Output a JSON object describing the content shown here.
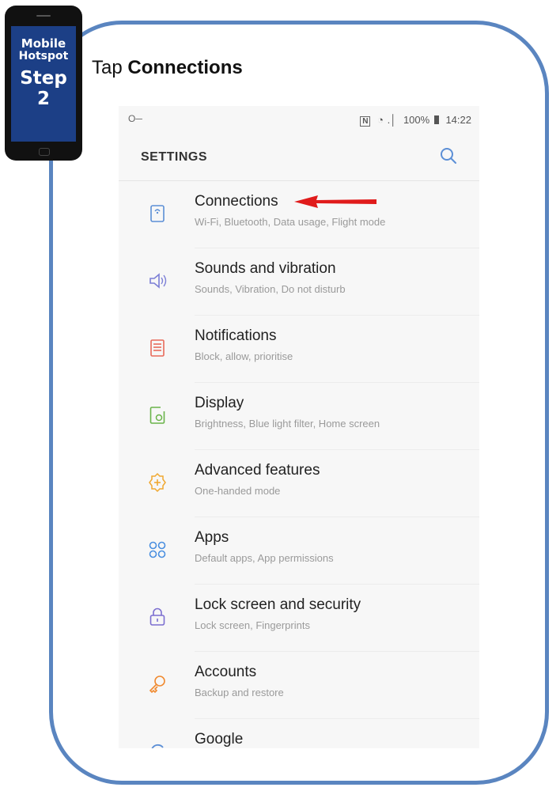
{
  "badge": {
    "line1": "Mobile",
    "line2": "Hotspot",
    "line3": "Step",
    "line4": "2"
  },
  "instruction": {
    "prefix": "Tap ",
    "target": "Connections"
  },
  "status_bar": {
    "key_icon": "key-icon",
    "nfc": "N",
    "battery": "100%",
    "time": "14:22"
  },
  "settings": {
    "title": "SETTINGS",
    "items": [
      {
        "label": "Connections",
        "sub": "Wi-Fi, Bluetooth, Data usage, Flight mode",
        "icon": "connections-icon",
        "color": "#5c8fd6"
      },
      {
        "label": "Sounds and vibration",
        "sub": "Sounds, Vibration, Do not disturb",
        "icon": "speaker-icon",
        "color": "#7c7fd6"
      },
      {
        "label": "Notifications",
        "sub": "Block, allow, prioritise",
        "icon": "notifications-icon",
        "color": "#e86a5a"
      },
      {
        "label": "Display",
        "sub": "Brightness, Blue light filter, Home screen",
        "icon": "display-icon",
        "color": "#6ab44a"
      },
      {
        "label": "Advanced features",
        "sub": "One-handed mode",
        "icon": "gear-plus-icon",
        "color": "#f0a830"
      },
      {
        "label": "Apps",
        "sub": "Default apps, App permissions",
        "icon": "apps-icon",
        "color": "#4a8fe0"
      },
      {
        "label": "Lock screen and security",
        "sub": "Lock screen, Fingerprints",
        "icon": "lock-icon",
        "color": "#7c6fd0"
      },
      {
        "label": "Accounts",
        "sub": "Backup and restore",
        "icon": "key-icon",
        "color": "#f08a30"
      },
      {
        "label": "Google",
        "sub": "",
        "icon": "google-icon",
        "color": "#5c8fd6"
      }
    ]
  },
  "colors": {
    "frame": "#5a85c0",
    "arrow": "#e01b1b",
    "badge_bg": "#1c3f86"
  }
}
